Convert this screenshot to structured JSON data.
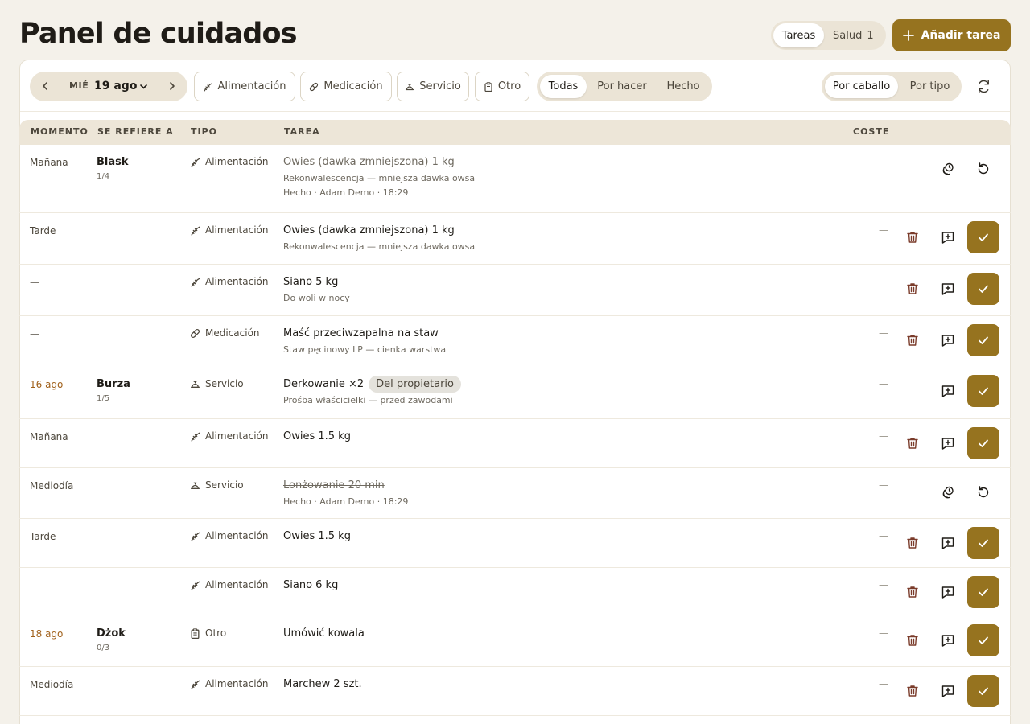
{
  "page": {
    "title": "Panel de cuidados"
  },
  "view_toggle": {
    "tasks": "Tareas",
    "health": "Salud",
    "health_count": "1"
  },
  "add_button": {
    "label": "Añadir tarea"
  },
  "date_nav": {
    "weekday": "MIÉ",
    "date": "19 ago"
  },
  "type_filters": [
    {
      "label": "Alimentación",
      "icon": "feed-icon"
    },
    {
      "label": "Medicación",
      "icon": "medication-icon"
    },
    {
      "label": "Servicio",
      "icon": "service-icon"
    },
    {
      "label": "Otro",
      "icon": "clipboard-icon"
    }
  ],
  "status_filter": {
    "all": "Todas",
    "todo": "Por hacer",
    "done": "Hecho",
    "selected": "Todas"
  },
  "group_toggle": {
    "by_horse": "Por caballo",
    "by_type": "Por tipo",
    "selected": "Por caballo"
  },
  "table": {
    "headers": {
      "when": "MOMENTO",
      "refers": "SE REFIERE A",
      "type": "TIPO",
      "task": "TAREA",
      "cost": "COSTE"
    },
    "rows": [
      {
        "when": "Mañana",
        "horse": "Blask",
        "horse_count": "1/4",
        "type": "Alimentación",
        "type_icon": "feed-icon",
        "task": "Owies (dawka zmniejszona) 1 kg",
        "note": "Rekonwalescencja — mniejsza dawka owsa",
        "meta": "Hecho · Adam Demo · 18:29",
        "done": true,
        "cost": "—"
      },
      {
        "when": "Tarde",
        "type": "Alimentación",
        "type_icon": "feed-icon",
        "task": "Owies (dawka zmniejszona) 1 kg",
        "note": "Rekonwalescencja — mniejsza dawka owsa",
        "done": false,
        "cost": "—"
      },
      {
        "when": "—",
        "type": "Alimentación",
        "type_icon": "feed-icon",
        "task": "Siano 5 kg",
        "note": "Do woli w nocy",
        "done": false,
        "cost": "—"
      },
      {
        "when": "—",
        "type": "Medicación",
        "type_icon": "medication-icon",
        "task": "Maść przeciwzapalna na staw",
        "note": "Staw pęcinowy LP — cienka warstwa",
        "done": false,
        "cost": "—"
      },
      {
        "when": "16 ago",
        "horse": "Burza",
        "horse_count": "1/5",
        "type": "Servicio",
        "type_icon": "service-icon",
        "task": "Derkowanie ×2",
        "badge": "Del propietario",
        "note": "Prośba właścicielki — przed zawodami",
        "done": false,
        "cost": "—"
      },
      {
        "when": "Mañana",
        "type": "Alimentación",
        "type_icon": "feed-icon",
        "task": "Owies 1.5 kg",
        "done": false,
        "cost": "—"
      },
      {
        "when": "Mediodía",
        "type": "Servicio",
        "type_icon": "service-icon",
        "task": "Lonżowanie 20 min",
        "meta": "Hecho · Adam Demo · 18:29",
        "done": true,
        "cost": "—"
      },
      {
        "when": "Tarde",
        "type": "Alimentación",
        "type_icon": "feed-icon",
        "task": "Owies 1.5 kg",
        "done": false,
        "cost": "—"
      },
      {
        "when": "—",
        "type": "Alimentación",
        "type_icon": "feed-icon",
        "task": "Siano 6 kg",
        "done": false,
        "cost": "—"
      },
      {
        "when": "18 ago",
        "horse": "Dżok",
        "horse_count": "0/3",
        "type": "Otro",
        "type_icon": "clipboard-icon",
        "task": "Umówić kowala",
        "done": false,
        "cost": "—"
      },
      {
        "when": "Mediodía",
        "type": "Alimentación",
        "type_icon": "feed-icon",
        "task": "Marchew 2 szt.",
        "done": false,
        "cost": "—"
      }
    ]
  },
  "colors": {
    "accent": "#96731f",
    "background": "#f4f1ea",
    "header_bg": "#ede6d8",
    "overdue": "#a0601a",
    "delete": "#7a3b2a"
  }
}
